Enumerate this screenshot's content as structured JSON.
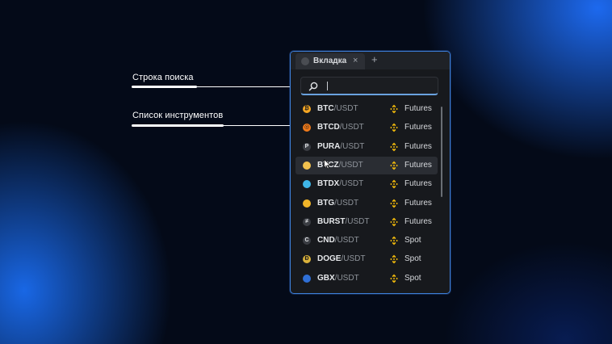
{
  "callouts": {
    "search": {
      "label": "Строка поиска"
    },
    "list": {
      "label": "Список инструментов"
    }
  },
  "window": {
    "tab": {
      "title": "Вкладка",
      "close_glyph": "×",
      "add_glyph": "+"
    },
    "search": {
      "placeholder": "",
      "value": ""
    },
    "instruments": [
      {
        "base": "BTC",
        "quote": "/USDT",
        "market": "Futures",
        "coin_color": "#f5a623",
        "coin_glyph": "₿"
      },
      {
        "base": "BTCD",
        "quote": "/USDT",
        "market": "Futures",
        "coin_color": "#f07a1a",
        "coin_glyph": "◎"
      },
      {
        "base": "PURA",
        "quote": "/USDT",
        "market": "Futures",
        "coin_color": "#2b2e33",
        "coin_glyph": "P"
      },
      {
        "base": "BTCZ",
        "quote": "/USDT",
        "market": "Futures",
        "coin_color": "#f2c14e",
        "coin_glyph": ""
      },
      {
        "base": "BTDX",
        "quote": "/USDT",
        "market": "Futures",
        "coin_color": "#3fb6e8",
        "coin_glyph": ""
      },
      {
        "base": "BTG",
        "quote": "/USDT",
        "market": "Futures",
        "coin_color": "#f0b429",
        "coin_glyph": ""
      },
      {
        "base": "BURST",
        "quote": "/USDT",
        "market": "Futures",
        "coin_color": "#2b2e33",
        "coin_glyph": "≠"
      },
      {
        "base": "CND",
        "quote": "/USDT",
        "market": "Spot",
        "coin_color": "#2b2e33",
        "coin_glyph": "C"
      },
      {
        "base": "DOGE",
        "quote": "/USDT",
        "market": "Spot",
        "coin_color": "#d9b13b",
        "coin_glyph": "Đ"
      },
      {
        "base": "GBX",
        "quote": "/USDT",
        "market": "Spot",
        "coin_color": "#2f6fd6",
        "coin_glyph": ""
      }
    ],
    "highlighted_index": 3,
    "exchange_icon": "binance-diamond-icon",
    "exchange_color": "#f0b90b"
  }
}
